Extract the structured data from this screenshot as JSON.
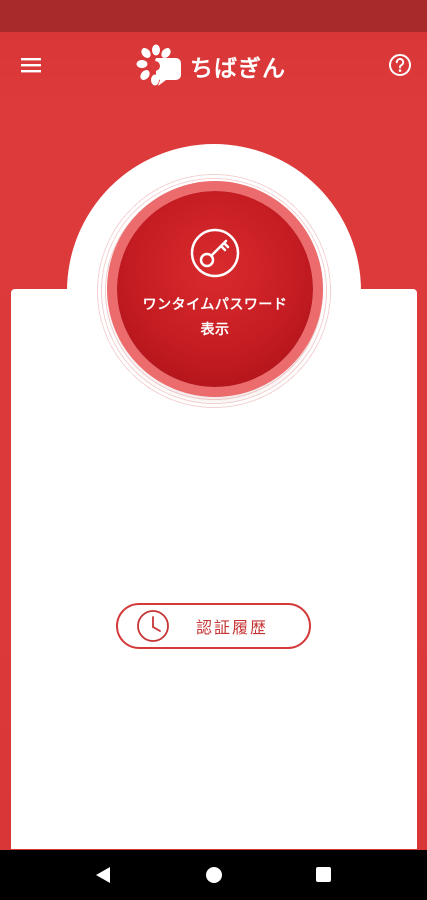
{
  "header": {
    "logo_text": "ちばぎん",
    "menu_icon": "hamburger-menu-icon",
    "help_icon": "question-circle-icon"
  },
  "main": {
    "otp_button": {
      "line1": "ワンタイムパスワード",
      "line2": "表示",
      "icon": "key-icon"
    },
    "history_button": {
      "label": "認証履歴",
      "icon": "clock-icon"
    }
  },
  "nav": {
    "back_icon": "back-triangle-icon",
    "home_icon": "home-circle-icon",
    "recents_icon": "recents-square-icon"
  },
  "colors": {
    "brand_red": "#dd3a3b",
    "status_bar": "#a82a2a",
    "button_red": "#c41c22",
    "history_border": "#d43a3a"
  }
}
